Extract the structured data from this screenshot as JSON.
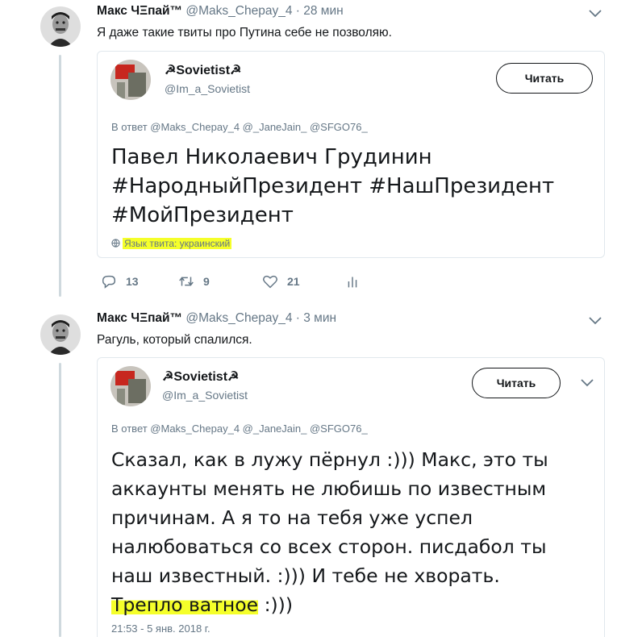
{
  "tweet1": {
    "author_name": "Макс ЧΞпай™",
    "author_handle": "@Maks_Chepay_4",
    "separator": "·",
    "time": "28 мин",
    "text": "Я даже такие твиты про Путина себе не позволяю.",
    "quote": {
      "name": "☭Sovietist☭",
      "handle": "@Im_a_Sovietist",
      "follow_label": "Читать",
      "reply_to": "В ответ @Maks_Chepay_4 @_JaneJain_ @SFGO76_",
      "text_lines": [
        "Павел Николаевич Грудинин",
        "#НародныйПрезидент #НашПрезидент",
        "#МойПрезидент"
      ],
      "lang_label": "Язык твита: украинский"
    },
    "actions": {
      "replies": "13",
      "retweets": "9",
      "likes": "21"
    }
  },
  "tweet2": {
    "author_name": "Макс ЧΞпай™",
    "author_handle": "@Maks_Chepay_4",
    "separator": "·",
    "time": "3 мин",
    "text": "Рагуль, который спалился.",
    "quote": {
      "name": "☭Sovietist☭",
      "handle": "@Im_a_Sovietist",
      "follow_label": "Читать",
      "reply_to": "В ответ @Maks_Chepay_4 @_JaneJain_ @SFGO76_",
      "text_lines": [
        "Сказал, как в лужу пёрнул :))) Макс, это ты",
        "аккаунты менять не любишь по известным",
        "причинам. А я то на тебя уже успел",
        "налюбоваться со всех сторон. писдабол ты",
        "наш известный. :))) И тебе не хворать."
      ],
      "last_line_highlight": "Трепло ватное",
      "last_line_rest": " :)))",
      "timestamp": "21:53 - 5 янв. 2018 г."
    }
  },
  "icons": [
    "chevron-down-icon",
    "reply-icon",
    "retweet-icon",
    "like-icon",
    "analytics-icon",
    "globe-icon"
  ],
  "colors": {
    "highlight": "#f5ff2a",
    "muted": "#657786",
    "border": "#e1e8ed",
    "thread_line": "#cfd9de"
  }
}
